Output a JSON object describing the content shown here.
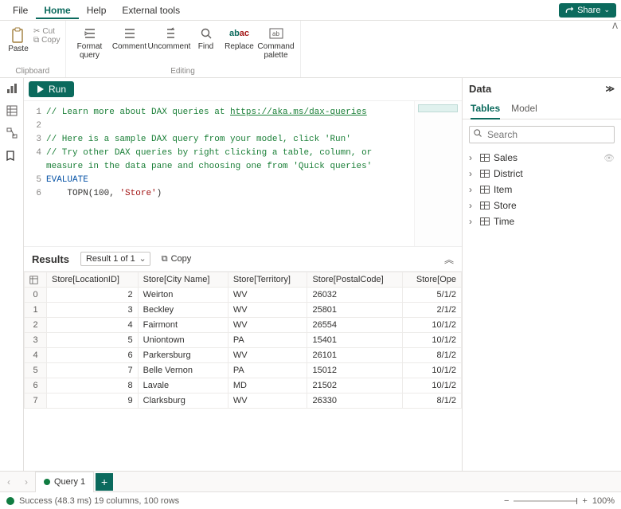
{
  "menu": {
    "file": "File",
    "home": "Home",
    "help": "Help",
    "ext": "External tools",
    "share": "Share"
  },
  "ribbon": {
    "paste": "Paste",
    "cut": "Cut",
    "copy": "Copy",
    "clip_group": "Clipboard",
    "format": "Format query",
    "comment": "Comment",
    "uncomment": "Uncomment",
    "find": "Find",
    "replace": "Replace",
    "cmdpal": "Command palette",
    "edit_group": "Editing"
  },
  "run": {
    "label": "Run"
  },
  "code": {
    "lines": [
      "1",
      "2",
      "3",
      "4",
      "5",
      "6"
    ],
    "l1a": "// Learn more about DAX queries at ",
    "l1b": "https://aka.ms/dax-queries",
    "l3": "// Here is a sample DAX query from your model, click 'Run'",
    "l4": "// Try other DAX queries by right clicking a table, column, or measure in the data pane and choosing one from 'Quick queries'",
    "l5": "EVALUATE",
    "l6a": "    TOPN(",
    "l6b": "100",
    "l6c": ", ",
    "l6d": "'Store'",
    "l6e": ")"
  },
  "results": {
    "title": "Results",
    "selector": "Result 1 of 1",
    "copy": "Copy"
  },
  "columns": [
    "Store[LocationID]",
    "Store[City Name]",
    "Store[Territory]",
    "Store[PostalCode]",
    "Store[Ope"
  ],
  "rows": [
    {
      "i": "0",
      "loc": "2",
      "city": "Weirton",
      "terr": "WV",
      "pc": "26032",
      "ope": "5/1/2"
    },
    {
      "i": "1",
      "loc": "3",
      "city": "Beckley",
      "terr": "WV",
      "pc": "25801",
      "ope": "2/1/2"
    },
    {
      "i": "2",
      "loc": "4",
      "city": "Fairmont",
      "terr": "WV",
      "pc": "26554",
      "ope": "10/1/2"
    },
    {
      "i": "3",
      "loc": "5",
      "city": "Uniontown",
      "terr": "PA",
      "pc": "15401",
      "ope": "10/1/2"
    },
    {
      "i": "4",
      "loc": "6",
      "city": "Parkersburg",
      "terr": "WV",
      "pc": "26101",
      "ope": "8/1/2"
    },
    {
      "i": "5",
      "loc": "7",
      "city": "Belle Vernon",
      "terr": "PA",
      "pc": "15012",
      "ope": "10/1/2"
    },
    {
      "i": "6",
      "loc": "8",
      "city": "Lavale",
      "terr": "MD",
      "pc": "21502",
      "ope": "10/1/2"
    },
    {
      "i": "7",
      "loc": "9",
      "city": "Clarksburg",
      "terr": "WV",
      "pc": "26330",
      "ope": "8/1/2"
    }
  ],
  "datapane": {
    "title": "Data",
    "tab1": "Tables",
    "tab2": "Model",
    "search": "Search",
    "tables": [
      "Sales",
      "District",
      "Item",
      "Store",
      "Time"
    ]
  },
  "qtab": {
    "name": "Query 1"
  },
  "status": {
    "text": "Success (48.3 ms) 19 columns, 100 rows",
    "zoom": "100%"
  }
}
